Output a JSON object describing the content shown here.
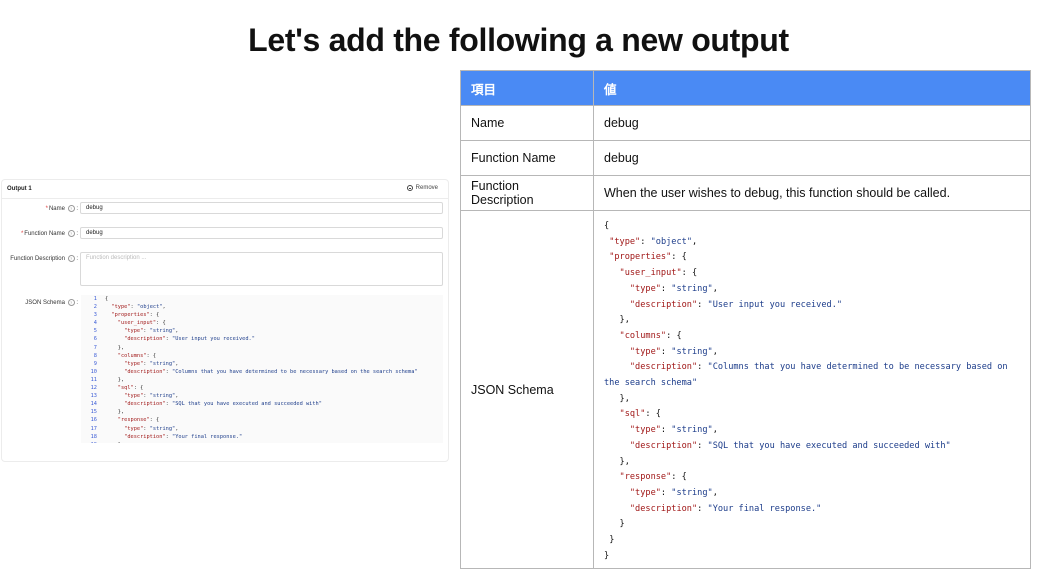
{
  "title": "Let's add the following a new output",
  "form": {
    "panel_title": "Output 1",
    "remove_label": "Remove",
    "fields": [
      {
        "label": "Name",
        "required": true,
        "value": "debug"
      },
      {
        "label": "Function Name",
        "required": true,
        "value": "debug"
      },
      {
        "label": "Function Description",
        "required": false,
        "placeholder": "Function description ..."
      },
      {
        "label": "JSON Schema",
        "required": false
      }
    ],
    "code_lines": [
      {
        "n": "1",
        "t": "{"
      },
      {
        "n": "2",
        "t": "  \"type\": \"object\","
      },
      {
        "n": "3",
        "t": "  \"properties\": {"
      },
      {
        "n": "4",
        "t": "    \"user_input\": {"
      },
      {
        "n": "5",
        "t": "      \"type\": \"string\","
      },
      {
        "n": "6",
        "t": "      \"description\": \"User input you received.\""
      },
      {
        "n": "7",
        "t": "    },"
      },
      {
        "n": "8",
        "t": "    \"columns\": {"
      },
      {
        "n": "9",
        "t": "      \"type\": \"string\","
      },
      {
        "n": "10",
        "t": "      \"description\": \"Columns that you have determined to be necessary based on the search schema\""
      },
      {
        "n": "11",
        "t": "    },"
      },
      {
        "n": "12",
        "t": "    \"sql\": {"
      },
      {
        "n": "13",
        "t": "      \"type\": \"string\","
      },
      {
        "n": "14",
        "t": "      \"description\": \"SQL that you have executed and succeeded with\""
      },
      {
        "n": "15",
        "t": "    },"
      },
      {
        "n": "16",
        "t": "    \"response\": {"
      },
      {
        "n": "17",
        "t": "      \"type\": \"string\","
      },
      {
        "n": "18",
        "t": "      \"description\": \"Your final response.\""
      },
      {
        "n": "19",
        "t": "    }"
      }
    ]
  },
  "table": {
    "headers": [
      "項目",
      "値"
    ],
    "rows": [
      {
        "key": "Name",
        "value": "debug"
      },
      {
        "key": "Function Name",
        "value": "debug"
      },
      {
        "key": "Function Description",
        "value": "When the user wishes to debug, this function should be called."
      }
    ],
    "schema_key": "JSON Schema",
    "schema_lines": [
      "{",
      " \"type\": \"object\",",
      " \"properties\": {",
      "   \"user_input\": {",
      "     \"type\": \"string\",",
      "     \"description\": \"User input you received.\"",
      "   },",
      "   \"columns\": {",
      "     \"type\": \"string\",",
      "     \"description\": \"Columns that you have determined to be necessary based on the search schema\"",
      "   },",
      "   \"sql\": {",
      "     \"type\": \"string\",",
      "     \"description\": \"SQL that you have executed and succeeded with\"",
      "   },",
      "   \"response\": {",
      "     \"type\": \"string\",",
      "     \"description\": \"Your final response.\"",
      "   }",
      " }",
      "}"
    ]
  },
  "colors": {
    "header_bg": "#4a8af4",
    "json_key": "#a01717",
    "json_string": "#1c3c8a",
    "required": "#e03a3a"
  }
}
